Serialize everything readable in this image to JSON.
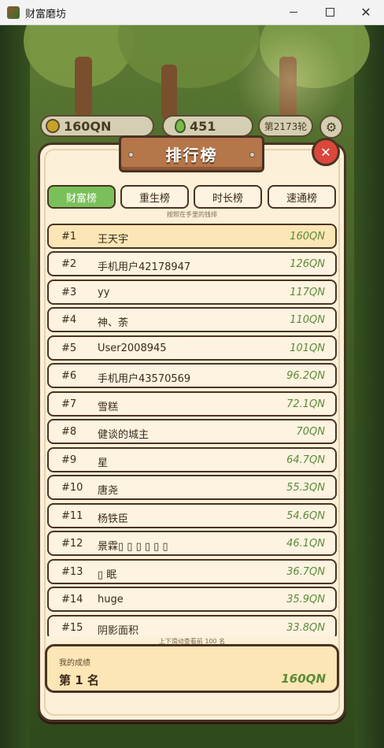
{
  "window": {
    "title": "财富磨坊"
  },
  "hud": {
    "money": "160QN",
    "seeds": "451",
    "round": "第2173轮"
  },
  "modal": {
    "title": "排行榜"
  },
  "tabs": [
    {
      "label": "财富榜",
      "active": true
    },
    {
      "label": "重生榜",
      "active": false
    },
    {
      "label": "时长榜",
      "active": false
    },
    {
      "label": "速通榜",
      "active": false
    }
  ],
  "tab_hint": "按照在手里的钱排",
  "leaderboard": [
    {
      "rank": "#1",
      "name": "王天宇",
      "value": "160QN"
    },
    {
      "rank": "#2",
      "name": "手机用户42178947",
      "value": "126QN"
    },
    {
      "rank": "#3",
      "name": "yy",
      "value": "117QN"
    },
    {
      "rank": "#4",
      "name": "神、荼",
      "value": "110QN"
    },
    {
      "rank": "#5",
      "name": "User2008945",
      "value": "101QN"
    },
    {
      "rank": "#6",
      "name": "手机用户43570569",
      "value": "96.2QN"
    },
    {
      "rank": "#7",
      "name": "雪糕",
      "value": "72.1QN"
    },
    {
      "rank": "#8",
      "name": "健谈的城主",
      "value": "70QN"
    },
    {
      "rank": "#9",
      "name": "星",
      "value": "64.7QN"
    },
    {
      "rank": "#10",
      "name": "唐尧",
      "value": "55.3QN"
    },
    {
      "rank": "#11",
      "name": "杨铁臣",
      "value": "54.6QN"
    },
    {
      "rank": "#12",
      "name": "景霖▯ ▯ ▯ ▯ ▯ ▯",
      "value": "46.1QN"
    },
    {
      "rank": "#13",
      "name": "▯ 眠",
      "value": "36.7QN"
    },
    {
      "rank": "#14",
      "name": "huge",
      "value": "35.9QN"
    },
    {
      "rank": "#15",
      "name": "阴影面积",
      "value": "33.8QN"
    }
  ],
  "scroll_hint": "上下滑动查看前 100 名",
  "my_score": {
    "label": "我的成绩",
    "rank": "第 1 名",
    "value": "160QN"
  }
}
